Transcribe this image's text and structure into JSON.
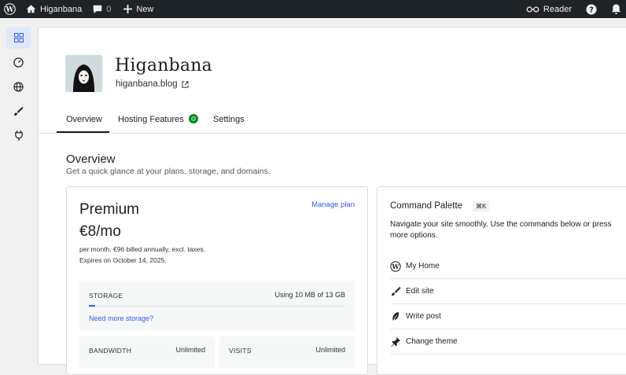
{
  "adminbar": {
    "site_name": "Higanbana",
    "comments_count": "0",
    "new_label": "New",
    "reader_label": "Reader"
  },
  "site": {
    "title": "Higanbana",
    "url": "higanbana.blog"
  },
  "tabs": [
    {
      "label": "Overview",
      "active": true
    },
    {
      "label": "Hosting Features"
    },
    {
      "label": "Settings"
    }
  ],
  "overview": {
    "title": "Overview",
    "subtitle": "Get a quick glance at your plans, storage, and domains."
  },
  "plan": {
    "name": "Premium",
    "manage_label": "Manage plan",
    "price": "€8/mo",
    "billing": "per month, €96 billed annually, excl. taxes.",
    "expires": "Expires on October 14, 2025.",
    "storage_label": "STORAGE",
    "storage_usage": "Using 10 MB of 13 GB",
    "storage_fraction": 0.0008,
    "need_more_storage": "Need more storage?",
    "bandwidth_label": "BANDWIDTH",
    "bandwidth_value": "Unlimited",
    "visits_label": "VISITS",
    "visits_value": "Unlimited"
  },
  "command_palette": {
    "title": "Command Palette",
    "shortcut": "⌘K",
    "description": "Navigate your site smoothly. Use the commands below or press more options.",
    "commands": [
      {
        "label": "My Home",
        "icon": "wordpress-icon"
      },
      {
        "label": "Edit site",
        "icon": "brush-icon"
      },
      {
        "label": "Write post",
        "icon": "feather-icon"
      },
      {
        "label": "Change theme",
        "icon": "pin-icon"
      }
    ]
  },
  "colors": {
    "accent": "#3858e9",
    "adminbar_bg": "#1d2327",
    "badge": "#008a20"
  }
}
